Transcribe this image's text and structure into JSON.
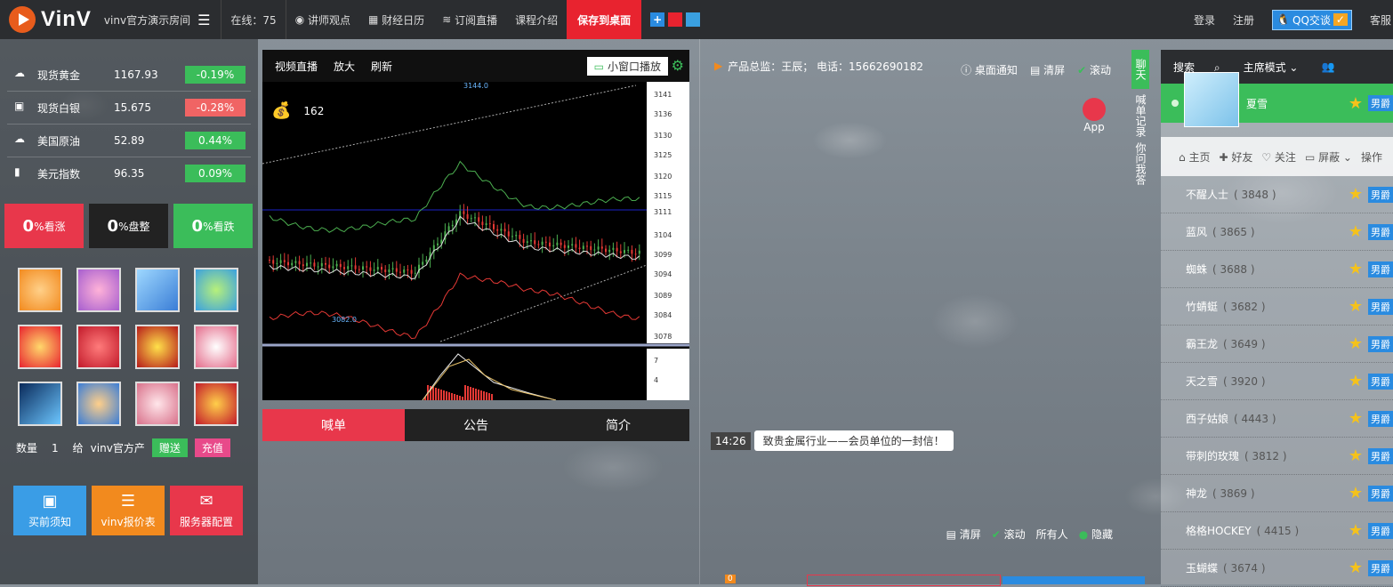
{
  "header": {
    "logo": "VinV",
    "room": "vinv官方演示房间",
    "menu": [
      "在线：75",
      "讲师观点",
      "财经日历",
      "订阅直播",
      "课程介绍"
    ],
    "save_desktop": "保存到桌面",
    "login": "登录",
    "register": "注册",
    "qq": "QQ交谈",
    "service": "客服"
  },
  "quotes": [
    {
      "name": "现货黄金",
      "value": "1167.93",
      "change": "-0.19%",
      "dir": "up"
    },
    {
      "name": "现货白银",
      "value": "15.675",
      "change": "-0.28%",
      "dir": "dn"
    },
    {
      "name": "美国原油",
      "value": "52.89",
      "change": "0.44%",
      "dir": "up"
    },
    {
      "name": "美元指数",
      "value": "96.35",
      "change": "0.09%",
      "dir": "up"
    }
  ],
  "vote": {
    "rise": "0",
    "rise_label": "%看涨",
    "flat": "0",
    "flat_label": "%盘整",
    "fall": "0",
    "fall_label": "%看跌"
  },
  "send": {
    "qty_label": "数量",
    "qty": "1",
    "to_label": "给",
    "to": "vinv官方产",
    "give": "赠送",
    "recharge": "充值"
  },
  "actions": [
    "买前须知",
    "vinv报价表",
    "服务器配置"
  ],
  "video": {
    "live": "视频直播",
    "zoom": "放大",
    "refresh": "刷新",
    "small_window": "小窗口播放",
    "viewers": "162"
  },
  "chart_data": {
    "type": "candlestick",
    "price_ticks": [
      "3141",
      "3136",
      "3130",
      "3125",
      "3120",
      "3115",
      "3111",
      "3104",
      "3099",
      "3094",
      "3089",
      "3084",
      "3078"
    ],
    "high_label": "3144.0",
    "low_label": "3082.0",
    "macd_ticks": [
      "7",
      "4"
    ]
  },
  "tabs": [
    "喊单",
    "公告",
    "简介"
  ],
  "chat": {
    "director": "产品总监：王辰；  电话：15662690182",
    "desktop_notify": "桌面通知",
    "clear": "清屏",
    "scroll": "滚动",
    "app": "App",
    "msg_time": "14:26",
    "msg_text": "致贵金属行业——会员单位的一封信！",
    "all": "所有人",
    "hide": "隐藏"
  },
  "sidetab": {
    "chat": "聊天",
    "orders": "喊单记录",
    "qa": "你问我答"
  },
  "users": {
    "search": "搜索",
    "mode": "主席模式",
    "me": "夏雪",
    "ops": [
      "主页",
      "好友",
      "关注",
      "屏蔽",
      "操作"
    ],
    "list": [
      {
        "name": "不醒人士",
        "id": "( 3848 )"
      },
      {
        "name": "蓝风",
        "id": "( 3865 )"
      },
      {
        "name": "蜘蛛",
        "id": "( 3688 )"
      },
      {
        "name": "竹蜻蜓",
        "id": "( 3682 )"
      },
      {
        "name": "霸王龙",
        "id": "( 3649 )"
      },
      {
        "name": "天之雪",
        "id": "( 3920 )"
      },
      {
        "name": "西子姑娘",
        "id": "( 4443 )"
      },
      {
        "name": "带刺的玫瑰",
        "id": "( 3812 )"
      },
      {
        "name": "神龙",
        "id": "( 3869 )"
      },
      {
        "name": "格格HOCKEY",
        "id": "( 4415 )"
      },
      {
        "name": "玉蝴蝶",
        "id": "( 3674 )"
      }
    ],
    "tag": "男爵"
  }
}
